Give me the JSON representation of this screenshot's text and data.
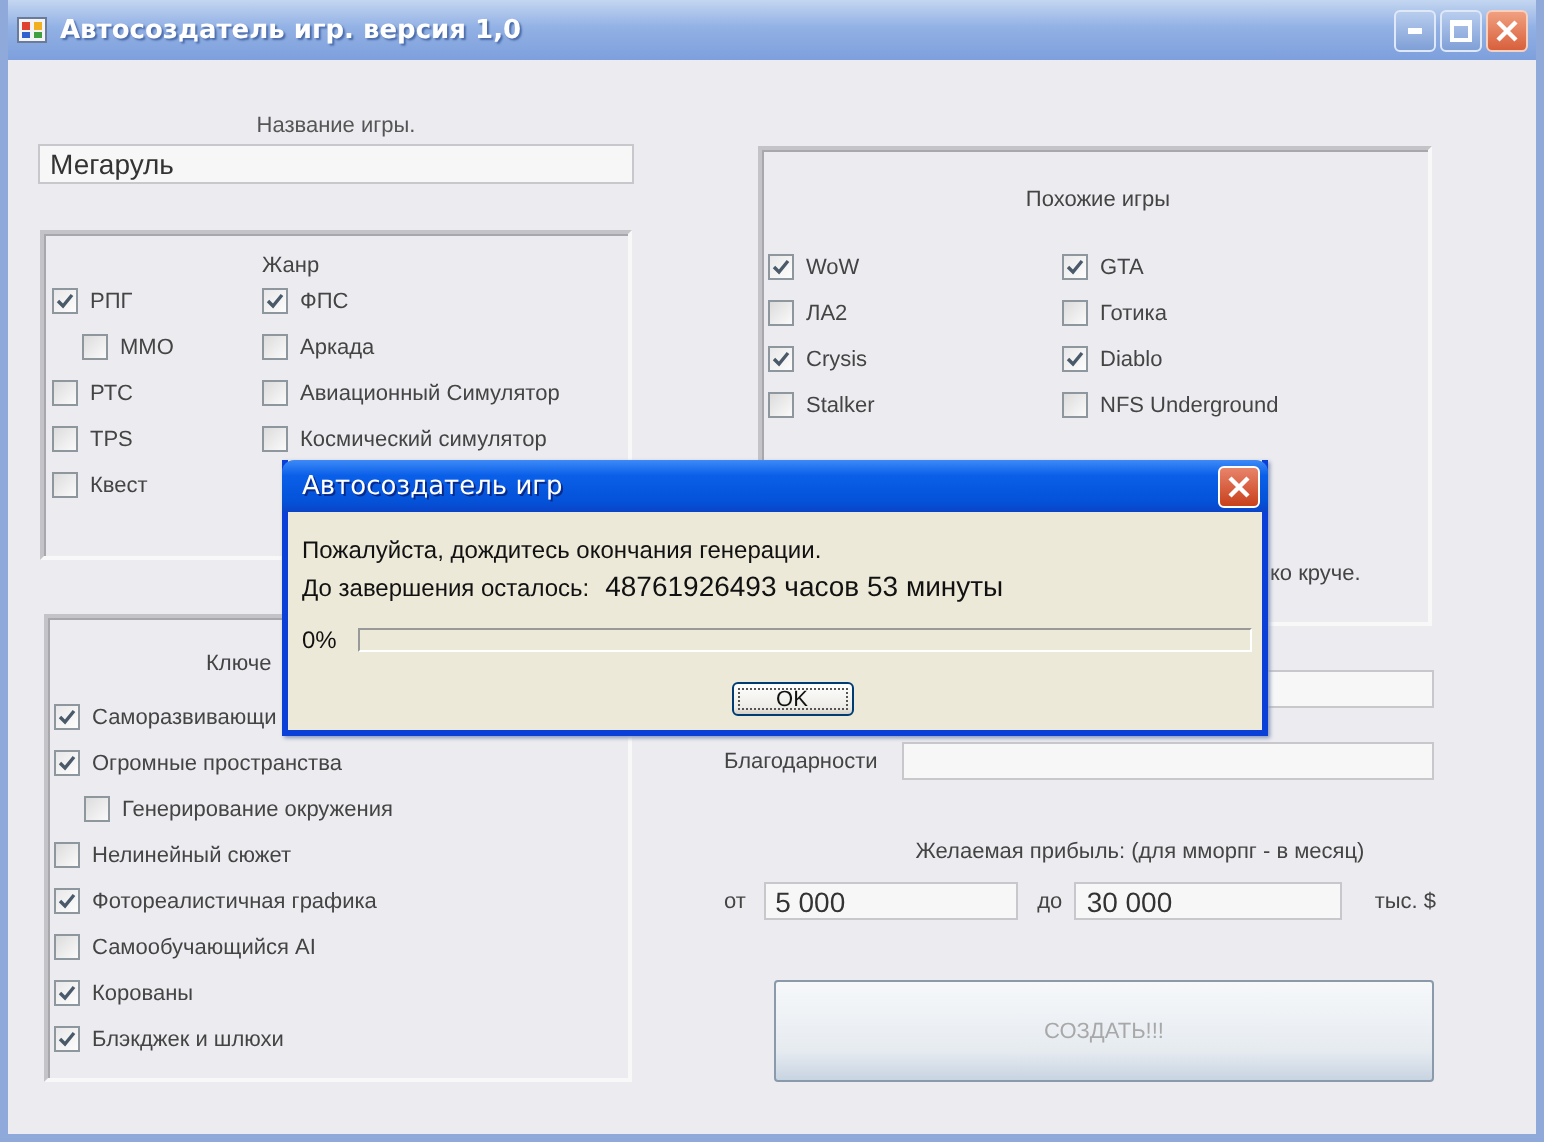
{
  "window": {
    "title": "Автосоздатель игр. версия 1,0"
  },
  "name_field": {
    "label": "Название игры.",
    "value": "Мегаруль"
  },
  "genre": {
    "title": "Жанр",
    "columns": [
      [
        {
          "label": "РПГ",
          "checked": true,
          "children": [
            {
              "label": "ММО",
              "checked": false
            }
          ]
        },
        {
          "label": "РТС",
          "checked": false
        },
        {
          "label": "TPS",
          "checked": false
        },
        {
          "label": "Квест",
          "checked": false
        }
      ],
      [
        {
          "label": "ФПС",
          "checked": true
        },
        {
          "label": "Аркада",
          "checked": false
        },
        {
          "label": "Авиационный Симулятор",
          "checked": false
        },
        {
          "label": "Космический симулятор",
          "checked": false
        }
      ]
    ]
  },
  "key_features": {
    "title": "Ключе",
    "items": [
      {
        "label": "Саморазвивающи",
        "checked": true
      },
      {
        "label": "Огромные пространства",
        "checked": true,
        "children": [
          {
            "label": "Генерирование окружения",
            "checked": false
          }
        ]
      },
      {
        "label": "Нелинейный сюжет",
        "checked": false
      },
      {
        "label": "Фотореалистичная графика",
        "checked": true
      },
      {
        "label": "Самообучающийся AI",
        "checked": false
      },
      {
        "label": "Корованы",
        "checked": true
      },
      {
        "label": "Блэкджек и шлюхи",
        "checked": true
      }
    ]
  },
  "similar_games": {
    "title": "Похожие игры",
    "columns": [
      [
        {
          "label": "WoW",
          "checked": true
        },
        {
          "label": "ЛА2",
          "checked": false
        },
        {
          "label": "Crysis",
          "checked": true
        },
        {
          "label": "Stalker",
          "checked": false
        }
      ],
      [
        {
          "label": "GTA",
          "checked": true
        },
        {
          "label": "Готика",
          "checked": false
        },
        {
          "label": "Diablo",
          "checked": true
        },
        {
          "label": "NFS Underground",
          "checked": false
        }
      ]
    ],
    "note": "ко круче."
  },
  "fields": [
    {
      "kind": "text"
    },
    {
      "kind": "text",
      "label": "Благодарности"
    }
  ],
  "profit": {
    "label": "Желаемая прибыль: (для мморпг - в месяц)",
    "from_label": "от",
    "from": "5 000",
    "to_label": "до",
    "to": "30 000",
    "unit": "тыс. $"
  },
  "create_button": {
    "label": "СОЗДАТЬ!!!",
    "disabled": true
  },
  "dialog": {
    "title": "Автосоздатель игр",
    "message": "Пожалуйста, дождитесь окончания генерации.",
    "remaining_label": "До завершения осталось:",
    "remaining_value": "48761926493 часов 53 минуты",
    "progress": {
      "text": "0%",
      "level": 0
    },
    "button": "OK"
  }
}
